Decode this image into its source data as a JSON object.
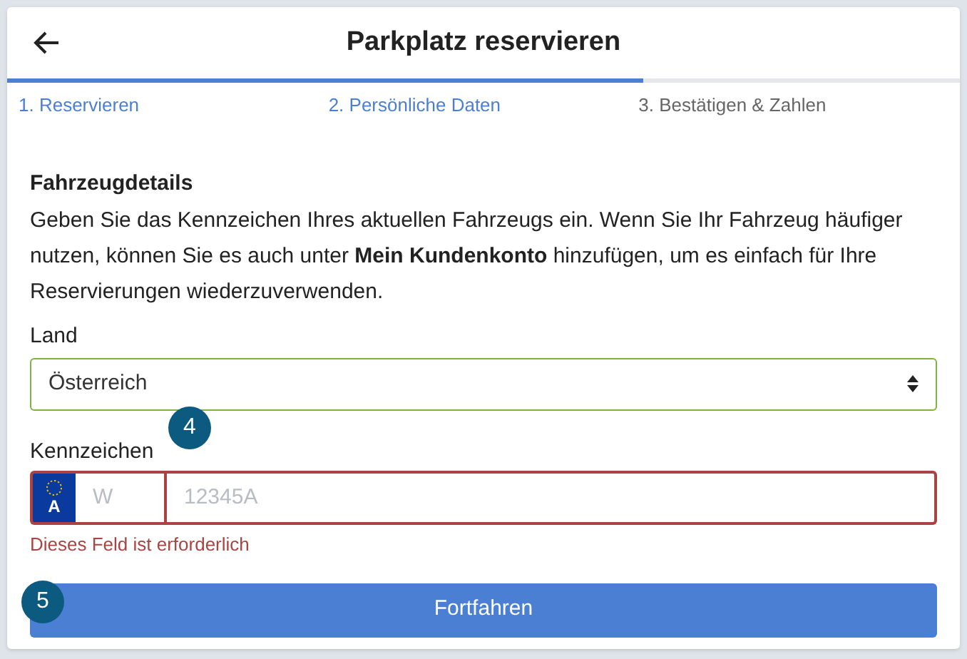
{
  "header": {
    "title": "Parkplatz reservieren"
  },
  "progress": {
    "level": 0.667
  },
  "steps": [
    {
      "label": "1. Reservieren",
      "active": true
    },
    {
      "label": "2. Persönliche Daten",
      "active": true
    },
    {
      "label": "3. Bestätigen & Zahlen",
      "active": false
    }
  ],
  "section": {
    "title": "Fahrzeugdetails",
    "text": "Geben Sie das Kennzeichen Ihres aktuellen Fahrzeugs ein. Wenn Sie Ihr Fahrzeug häufiger nutzen, können Sie es auch unter **Mein Kundenkonto** hinzufügen, um es einfach für Ihre Reservierungen wiederzuverwenden."
  },
  "country": {
    "label": "Land",
    "value": "Österreich",
    "valid": true
  },
  "plate": {
    "label": "Kennzeichen",
    "country_code": "A",
    "district_placeholder": "W",
    "number_placeholder": "12345A",
    "invalid": true,
    "error": "Dieses Feld ist erforderlich"
  },
  "submit": {
    "label": "Fortfahren"
  },
  "callouts": [
    {
      "label": "4",
      "kind": "plate"
    },
    {
      "label": "5",
      "kind": "submit"
    }
  ]
}
